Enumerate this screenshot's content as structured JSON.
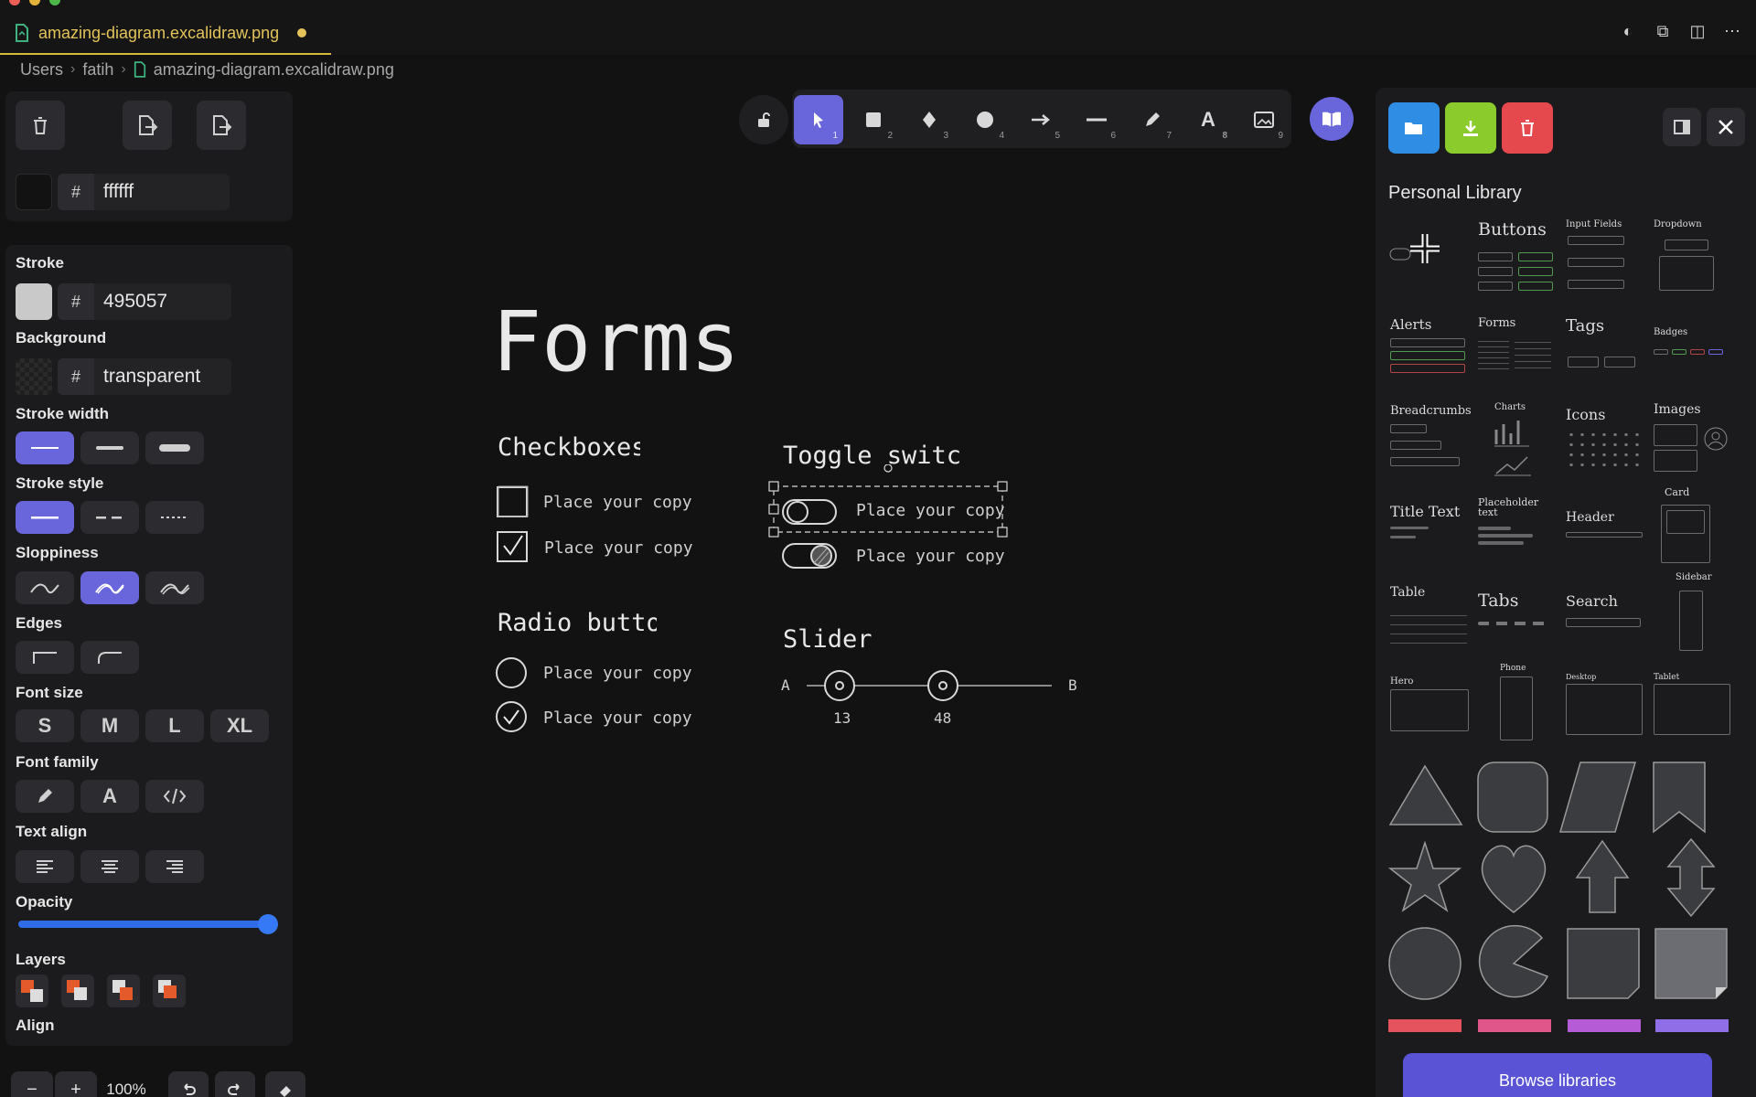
{
  "tab": {
    "filename": "amazing-diagram.excalidraw.png"
  },
  "breadcrumb": {
    "items": [
      "Users",
      "fatih",
      "amazing-diagram.excalidraw.png"
    ]
  },
  "canvas_bg": {
    "hash": "#",
    "value": "ffffff"
  },
  "properties": {
    "stroke": {
      "label": "Stroke",
      "hash": "#",
      "value": "495057"
    },
    "background": {
      "label": "Background",
      "hash": "#",
      "value": "transparent"
    },
    "stroke_width": {
      "label": "Stroke width"
    },
    "stroke_style": {
      "label": "Stroke style"
    },
    "sloppiness": {
      "label": "Sloppiness"
    },
    "edges": {
      "label": "Edges"
    },
    "font_size": {
      "label": "Font size",
      "options": [
        "S",
        "M",
        "L",
        "XL"
      ]
    },
    "font_family": {
      "label": "Font family",
      "options": [
        "pencil-icon",
        "A",
        "code-icon"
      ]
    },
    "text_align": {
      "label": "Text align"
    },
    "opacity": {
      "label": "Opacity",
      "value": 100
    },
    "layers": {
      "label": "Layers"
    },
    "align": {
      "label": "Align"
    }
  },
  "zoom": {
    "minus": "−",
    "plus": "+",
    "value": "100%"
  },
  "toolbar": {
    "tools": [
      {
        "name": "selection",
        "num": "1"
      },
      {
        "name": "rectangle",
        "num": "2"
      },
      {
        "name": "diamond",
        "num": "3"
      },
      {
        "name": "ellipse",
        "num": "4"
      },
      {
        "name": "arrow",
        "num": "5"
      },
      {
        "name": "line",
        "num": "6"
      },
      {
        "name": "draw",
        "num": "7"
      },
      {
        "name": "text",
        "num": "8"
      },
      {
        "name": "image",
        "num": "9"
      }
    ]
  },
  "drawing": {
    "title": "Forms",
    "checkboxes": {
      "heading": "Checkboxes",
      "items": [
        "Place your copy",
        "Place your copy"
      ]
    },
    "radio": {
      "heading": "Radio butto",
      "items": [
        "Place your copy",
        "Place your copy"
      ]
    },
    "toggle": {
      "heading": "Toggle switc",
      "items": [
        "Place your copy",
        "Place your copy"
      ]
    },
    "slider": {
      "heading": "Slider",
      "left": "A",
      "right": "B",
      "values": [
        "13",
        "48"
      ]
    }
  },
  "library": {
    "title": "Personal Library",
    "items": [
      {
        "label": "Buttons"
      },
      {
        "label": "Input Fields"
      },
      {
        "label": "Dropdown"
      },
      {
        "label": "Alerts"
      },
      {
        "label": "Forms"
      },
      {
        "label": "Tags"
      },
      {
        "label": "Badges"
      },
      {
        "label": "Breadcrumbs"
      },
      {
        "label": "Charts"
      },
      {
        "label": "Icons"
      },
      {
        "label": "Images"
      },
      {
        "label": "Title Text"
      },
      {
        "label": "Placeholder text"
      },
      {
        "label": "Header"
      },
      {
        "label": "Card"
      },
      {
        "label": "Table"
      },
      {
        "label": "Tabs"
      },
      {
        "label": "Search"
      },
      {
        "label": "Sidebar"
      },
      {
        "label": "Hero"
      },
      {
        "label": "Phone"
      },
      {
        "label": "Desktop"
      },
      {
        "label": "Tablet"
      }
    ],
    "browse_label": "Browse libraries",
    "colors": [
      "#e5535f",
      "#e0568a",
      "#b55bd6",
      "#8f6ee8"
    ]
  },
  "colors": {
    "accent": "#6965db",
    "open": "#2f8de4",
    "save": "#8bcb2b",
    "delete": "#e5484d"
  }
}
